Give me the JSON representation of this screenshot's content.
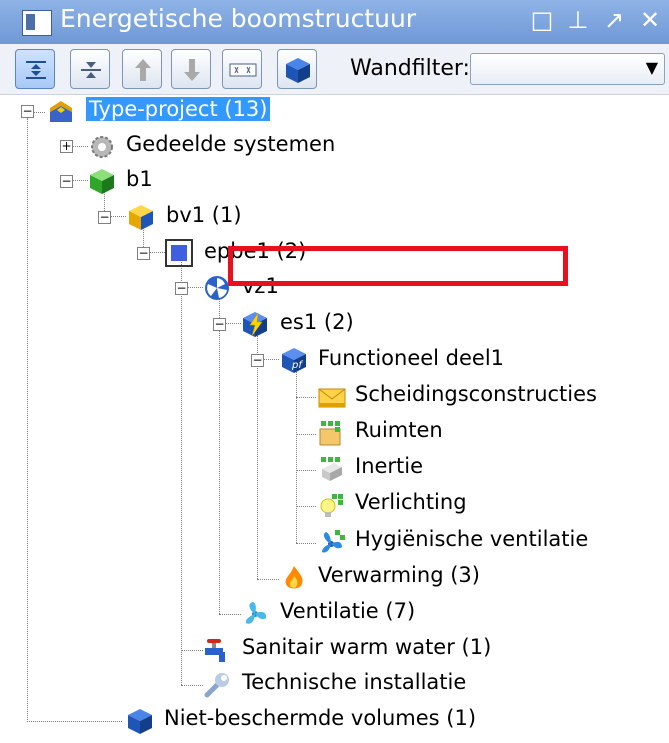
{
  "window": {
    "title": "Energetische boomstructuur"
  },
  "toolbar": {
    "filter_label": "Wandfilter:",
    "filter_value": ""
  },
  "tree": {
    "n0": "Type-project (13)",
    "n1": "Gedeelde systemen",
    "n2": "b1",
    "n3": "bv1 (1)",
    "n4": "epbe1 (2)",
    "n5": "vz1",
    "n6": "es1 (2)",
    "n7": "Functioneel deel1",
    "n8": "Scheidingsconstructies",
    "n9": "Ruimten",
    "n10": "Inertie",
    "n11": "Verlichting",
    "n12": "Hygiënische ventilatie",
    "n13": "Verwarming (3)",
    "n14": "Ventilatie (7)",
    "n15": "Sanitair warm water (1)",
    "n16": "Technische installatie",
    "n17": "Niet-beschermde volumes (1)"
  },
  "colors": {
    "selection": "#3399ff",
    "highlight": "#e8101e"
  }
}
